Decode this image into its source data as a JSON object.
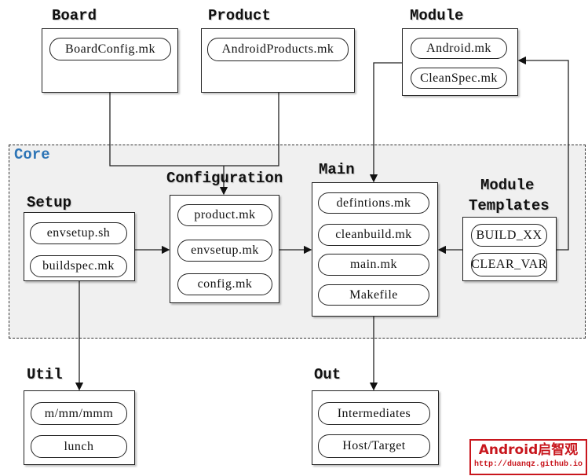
{
  "core_label": "Core",
  "board": {
    "label": "Board",
    "items": [
      "BoardConfig.mk"
    ]
  },
  "product": {
    "label": "Product",
    "items": [
      "AndroidProducts.mk"
    ]
  },
  "module": {
    "label": "Module",
    "items": [
      "Android.mk",
      "CleanSpec.mk"
    ]
  },
  "setup": {
    "label": "Setup",
    "items": [
      "envsetup.sh",
      "buildspec.mk"
    ]
  },
  "configuration": {
    "label": "Configuration",
    "items": [
      "product.mk",
      "envsetup.mk",
      "config.mk"
    ]
  },
  "main": {
    "label": "Main",
    "items": [
      "defintions.mk",
      "cleanbuild.mk",
      "main.mk",
      "Makefile"
    ]
  },
  "module_templates": {
    "label_line1": "Module",
    "label_line2": "Templates",
    "items": [
      "BUILD_XX",
      "CLEAR_VAR"
    ]
  },
  "util": {
    "label": "Util",
    "items": [
      "m/mm/mmm",
      "lunch"
    ]
  },
  "out": {
    "label": "Out",
    "items": [
      "Intermediates",
      "Host/Target"
    ]
  },
  "watermark": {
    "title": "Android启智观",
    "url": "http://duanqz.github.io"
  },
  "colors": {
    "core_label": "#2e75b6",
    "core_fill": "#f0f0f0",
    "watermark": "#c8161d"
  }
}
